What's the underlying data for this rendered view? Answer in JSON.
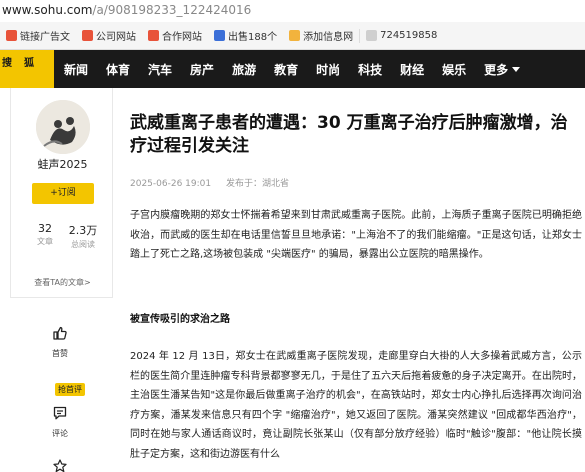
{
  "browser": {
    "url_host": "www.sohu.com",
    "url_path": "/a/908198233_122424016"
  },
  "bookmarks": [
    {
      "label": "链接广告文",
      "color": "#e8533a"
    },
    {
      "label": "公司网站",
      "color": "#e8533a"
    },
    {
      "label": "合作网站",
      "color": "#e8533a"
    },
    {
      "label": "出售188个",
      "color": "#3b6fd8"
    },
    {
      "label": "添加信息网",
      "color": "#f2b33d"
    },
    {
      "label": "724519858",
      "color": "#cfcfcf"
    }
  ],
  "site": {
    "logo_line1": "搜",
    "logo_line2": "狐",
    "nav": [
      "新闻",
      "体育",
      "汽车",
      "房产",
      "旅游",
      "教育",
      "时尚",
      "科技",
      "财经",
      "娱乐",
      "更多"
    ]
  },
  "author": {
    "name": "蛙声2025",
    "follow_label": "+订阅",
    "articles_count": "32",
    "articles_label": "文章",
    "reads_count": "2.3万",
    "reads_label": "总阅读",
    "all_articles_link": "查看TA的文章>"
  },
  "rail": {
    "like_label": "首赞",
    "comment_badge": "抢首评",
    "comment_label": "评论"
  },
  "article": {
    "title": "武威重离子患者的遭遇：30 万重离子治疗后肿瘤激增，治疗过程引发关注",
    "date": "2025-06-26 19:01",
    "source": "发布于：湖北省",
    "para1": "子宫内膜瘤晚期的郑女士怀揣着希望来到甘肃武威重离子医院。此前，上海质子重离子医院已明确拒绝收治，而武威的医生却在电话里信誓旦旦地承诺：\"上海治不了的我们能缩瘤。\"正是这句话，让郑女士踏上了死亡之路,这场被包装成 \"尖端医疗\" 的骗局，暴露出公立医院的暗黑操作。",
    "subheading": "被宣传吸引的求治之路",
    "para2": "2024 年 12 月 13日，郑女士在武威重离子医院发现，走廊里穿白大褂的人大多操着武威方言，公示栏的医生简介里连肿瘤专科背景都寥寥无几，于是住了五六天后拖着疲惫的身子决定离开。在出院时，主治医生潘某告知\"这是你最后做重离子治疗的机会\"，在高铁站时，郑女士内心挣扎后选择再次询问治疗方案，潘某发来信息只有四个字 \"缩瘤治疗\"，她又返回了医院。潘某突然建议 \"回成都华西治疗\"，同时在她与家人通话商议时，竟让副院长张某山（仅有部分放疗经验）临时\"触诊\"腹部：\"他让院长摸肚子定方案，这和街边游医有什么"
  }
}
